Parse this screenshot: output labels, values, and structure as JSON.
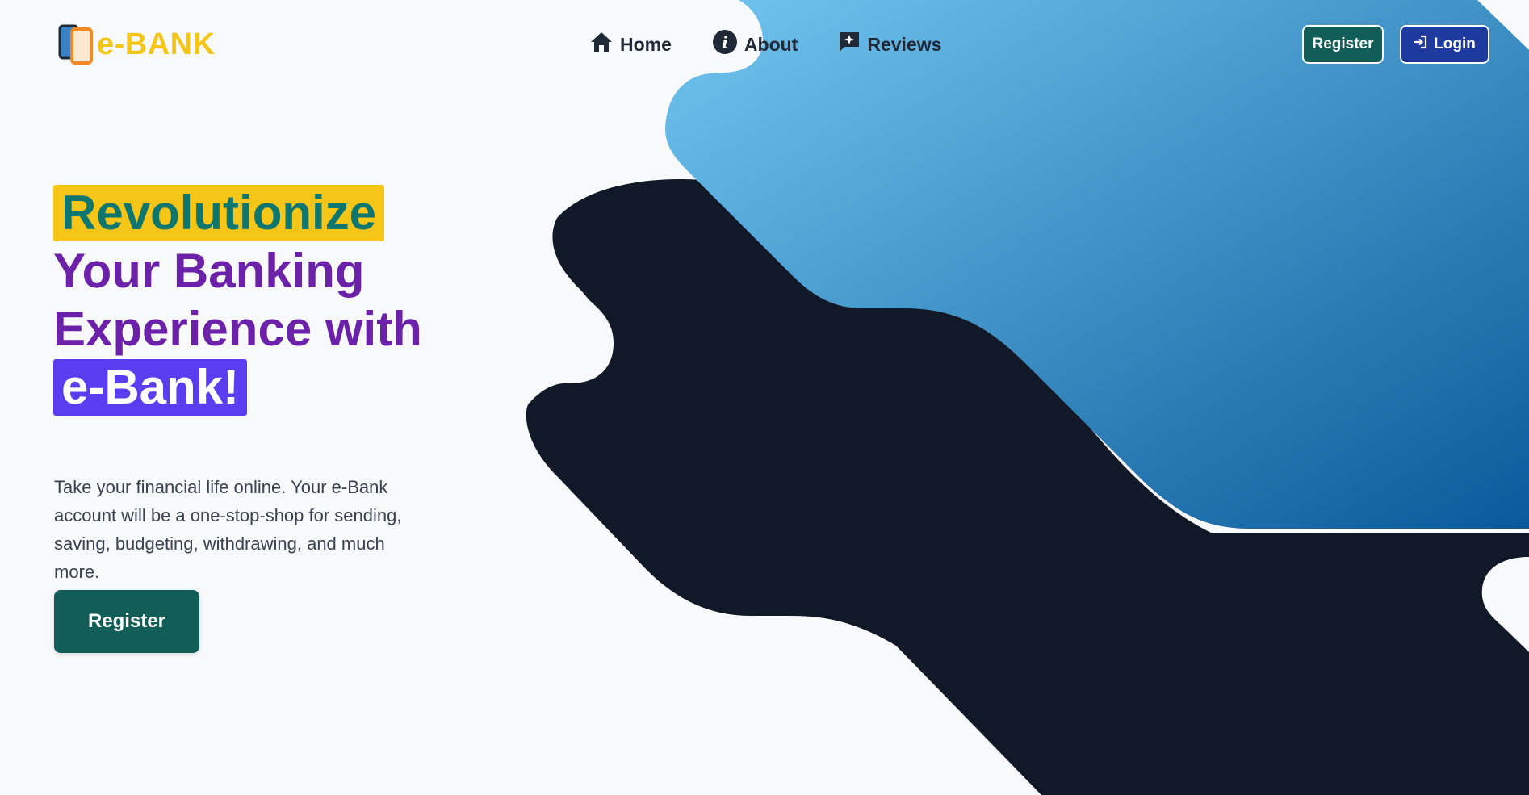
{
  "brand": {
    "name": "e-BANK"
  },
  "nav": {
    "items": [
      {
        "label": "Home",
        "icon": "home-icon"
      },
      {
        "label": "About",
        "icon": "info-icon"
      },
      {
        "label": "Reviews",
        "icon": "reviews-icon"
      }
    ]
  },
  "header": {
    "register_label": "Register",
    "login_label": "Login"
  },
  "hero": {
    "line1": "Revolutionize",
    "line2": "Your Banking",
    "line3": "Experience with",
    "line4": "e-Bank!",
    "description": "Take your financial life online. Your e-Bank account will be a one-stop-shop for sending, saving, budgeting, withdrawing, and much more.",
    "cta_label": "Register"
  },
  "colors": {
    "accent_yellow": "#f5c518",
    "teal": "#115e59",
    "navy_button": "#1e3a9e",
    "headline_purple": "#6b21a8",
    "highlight_purple": "#5b3df0",
    "dark_shape": "#111827",
    "gradient_light": "#6cc2ee",
    "gradient_dark": "#0a5a9a"
  }
}
